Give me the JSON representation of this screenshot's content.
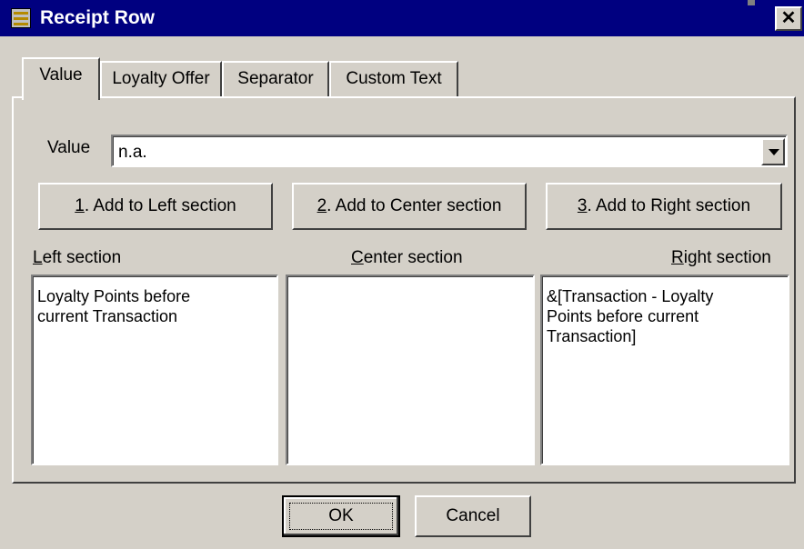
{
  "window": {
    "title": "Receipt Row",
    "close_glyph": "✕"
  },
  "tabs": [
    {
      "label": "Value",
      "active": true
    },
    {
      "label": "Loyalty Offer",
      "active": false
    },
    {
      "label": "Separator",
      "active": false
    },
    {
      "label": "Custom Text",
      "active": false
    }
  ],
  "value_field": {
    "label": "Value",
    "value": "n.a."
  },
  "add_buttons": {
    "left": {
      "mnemonic": "1",
      "rest": ". Add to Left section"
    },
    "center": {
      "mnemonic": "2",
      "rest": ". Add to Center section"
    },
    "right": {
      "mnemonic": "3",
      "rest": ". Add to Right section"
    }
  },
  "sections": {
    "left": {
      "mnemonic": "L",
      "rest": "eft section",
      "content": "Loyalty Points before\ncurrent Transaction"
    },
    "center": {
      "mnemonic": "C",
      "rest": "enter section",
      "content": ""
    },
    "right": {
      "mnemonic": "R",
      "rest": "ight section",
      "content": "&[Transaction - Loyalty\nPoints before current\nTransaction]"
    }
  },
  "footer": {
    "ok_label": "OK",
    "cancel_label": "Cancel"
  },
  "colors": {
    "titlebar": "#000080",
    "face": "#d4d0c8",
    "field": "#ffffff"
  }
}
